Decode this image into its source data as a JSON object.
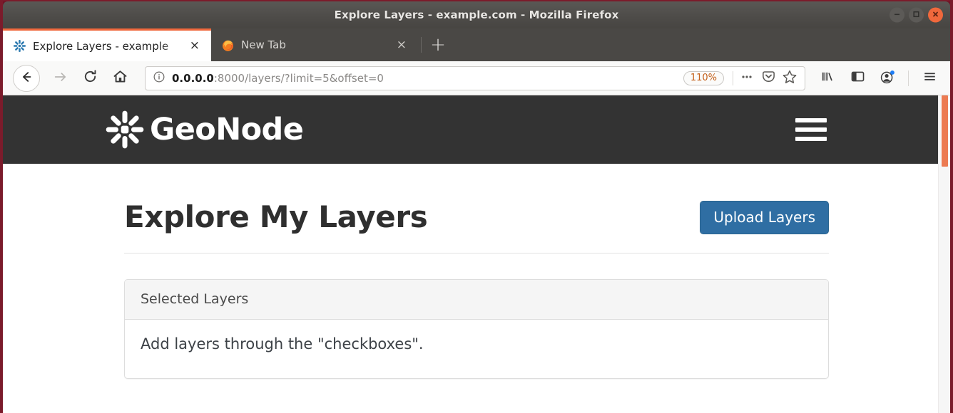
{
  "window": {
    "title": "Explore Layers - example.com - Mozilla Firefox",
    "controls": {
      "minimize": "–",
      "maximize": "□",
      "close": "×"
    }
  },
  "tabs": [
    {
      "label": "Explore Layers - example",
      "close": "×",
      "favicon": "geonode-favicon",
      "active": true
    },
    {
      "label": "New Tab",
      "close": "×",
      "favicon": "firefox-icon",
      "active": false
    }
  ],
  "newtab_label": "+",
  "toolbar": {
    "back": "back-arrow-icon",
    "forward": "forward-arrow-icon",
    "reload": "reload-icon",
    "home": "home-icon",
    "library": "library-icon",
    "sidebar": "sidebar-icon",
    "account": "account-icon",
    "menu": "hamburger-menu-icon"
  },
  "urlbar": {
    "info_icon": "page-info-icon",
    "host": "0.0.0.0",
    "path": ":8000/layers/?limit=5&offset=0",
    "zoom_level": "110%",
    "page_actions_icon": "ellipsis-icon",
    "pocket_icon": "pocket-icon",
    "bookmark_icon": "star-icon"
  },
  "site": {
    "brand_name": "GeoNode",
    "brand_mark": "geonode-logo-icon",
    "menu_toggle": "navbar-toggle-icon",
    "header_bg": "#333333"
  },
  "main": {
    "page_title": "Explore My Layers",
    "upload_button": "Upload Layers",
    "upload_button_color": "#2f6ea3",
    "panel": {
      "heading": "Selected Layers",
      "body_text": "Add layers through the \"checkboxes\"."
    }
  }
}
